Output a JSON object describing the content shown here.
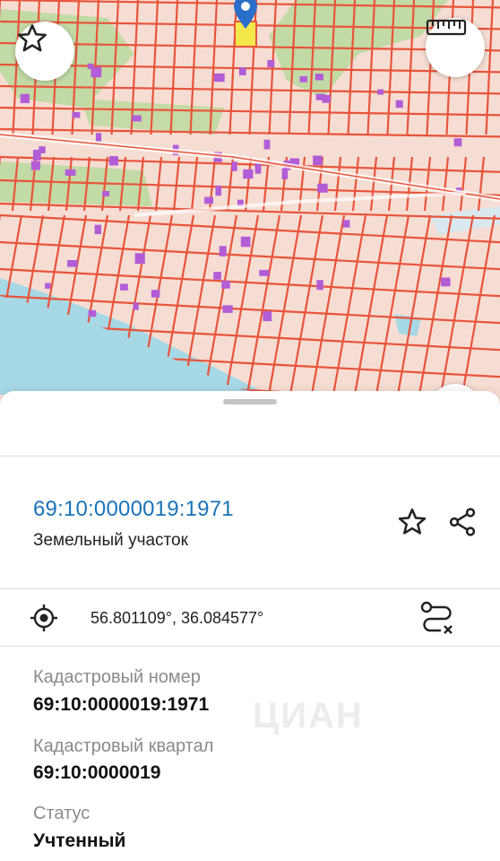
{
  "map": {
    "star_icon": "star-outline-icon",
    "ruler_icon": "ruler-icon",
    "marker_icon": "map-pin-icon",
    "colors": {
      "background": "#f6ddd3",
      "parcel_line": "#e8543a",
      "building": "#b25cd6",
      "green": "#bdd9a0",
      "water": "#a7d8e6"
    }
  },
  "parcel": {
    "cadastral_number": "69:10:0000019:1971",
    "type": "Земельный участок",
    "favorite_icon": "star-outline-icon",
    "share_icon": "share-icon"
  },
  "location": {
    "icon": "crosshair-location-icon",
    "coordinates": "56.801109°, 36.084577°",
    "route_icon": "route-icon"
  },
  "fields": [
    {
      "label": "Кадастровый номер",
      "value": "69:10:0000019:1971"
    },
    {
      "label": "Кадастровый квартал",
      "value": "69:10:0000019"
    },
    {
      "label": "Статус",
      "value": "Учтенный"
    }
  ],
  "watermark": "ЦИАН"
}
